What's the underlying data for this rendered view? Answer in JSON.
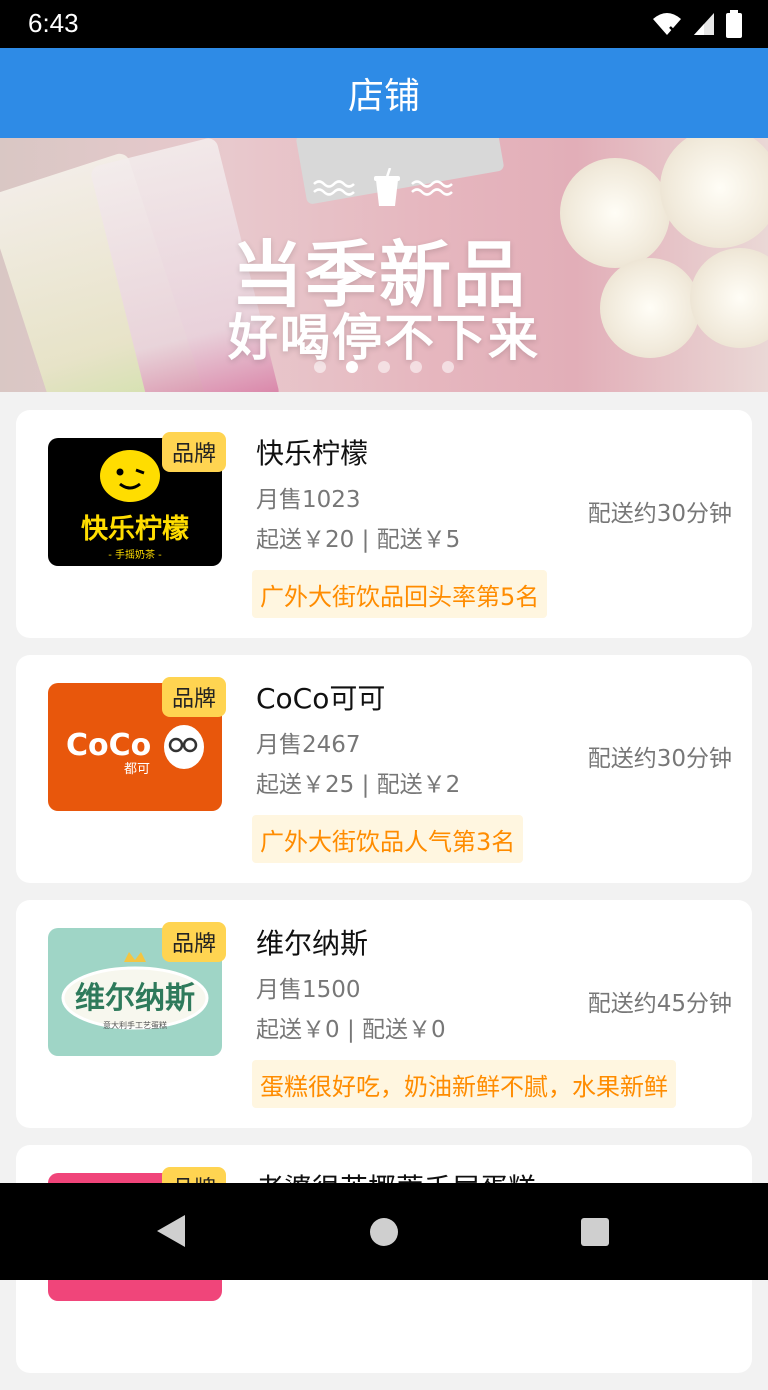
{
  "status": {
    "time": "6:43"
  },
  "appbar": {
    "title": "店铺"
  },
  "banner": {
    "headline": "当季新品",
    "subline": "好喝停不下来",
    "dots": 5,
    "active_dot": 2
  },
  "shops": [
    {
      "name": "快乐柠檬",
      "sales": "月售1023",
      "fees": "起送￥20 | 配送￥5",
      "eta": "配送约30分钟",
      "tag": "广外大街饮品回头率第5名",
      "badge": "品牌",
      "logo_text": "快乐柠檬",
      "logo_sub": "- 手摇奶茶 -"
    },
    {
      "name": "CoCo可可",
      "sales": "月售2467",
      "fees": "起送￥25 | 配送￥2",
      "eta": "配送约30分钟",
      "tag": "广外大街饮品人气第3名",
      "badge": "品牌",
      "logo_text": "CoCo",
      "logo_sub": "都可"
    },
    {
      "name": "维尔纳斯",
      "sales": "月售1500",
      "fees": "起送￥0 | 配送￥0",
      "eta": "配送约45分钟",
      "tag": "蛋糕很好吃，奶油新鲜不腻，水果新鲜",
      "badge": "品牌",
      "logo_text": "维尔纳斯",
      "logo_sub": "意大利手工艺蛋糕"
    },
    {
      "name": "老婆很苦椰蓉千层蛋糕",
      "badge": "品牌"
    }
  ],
  "colors": {
    "primary": "#2e8be6",
    "tag_text": "#ff8c00",
    "tag_bg": "#fff6e0",
    "badge": "#ffd451"
  }
}
